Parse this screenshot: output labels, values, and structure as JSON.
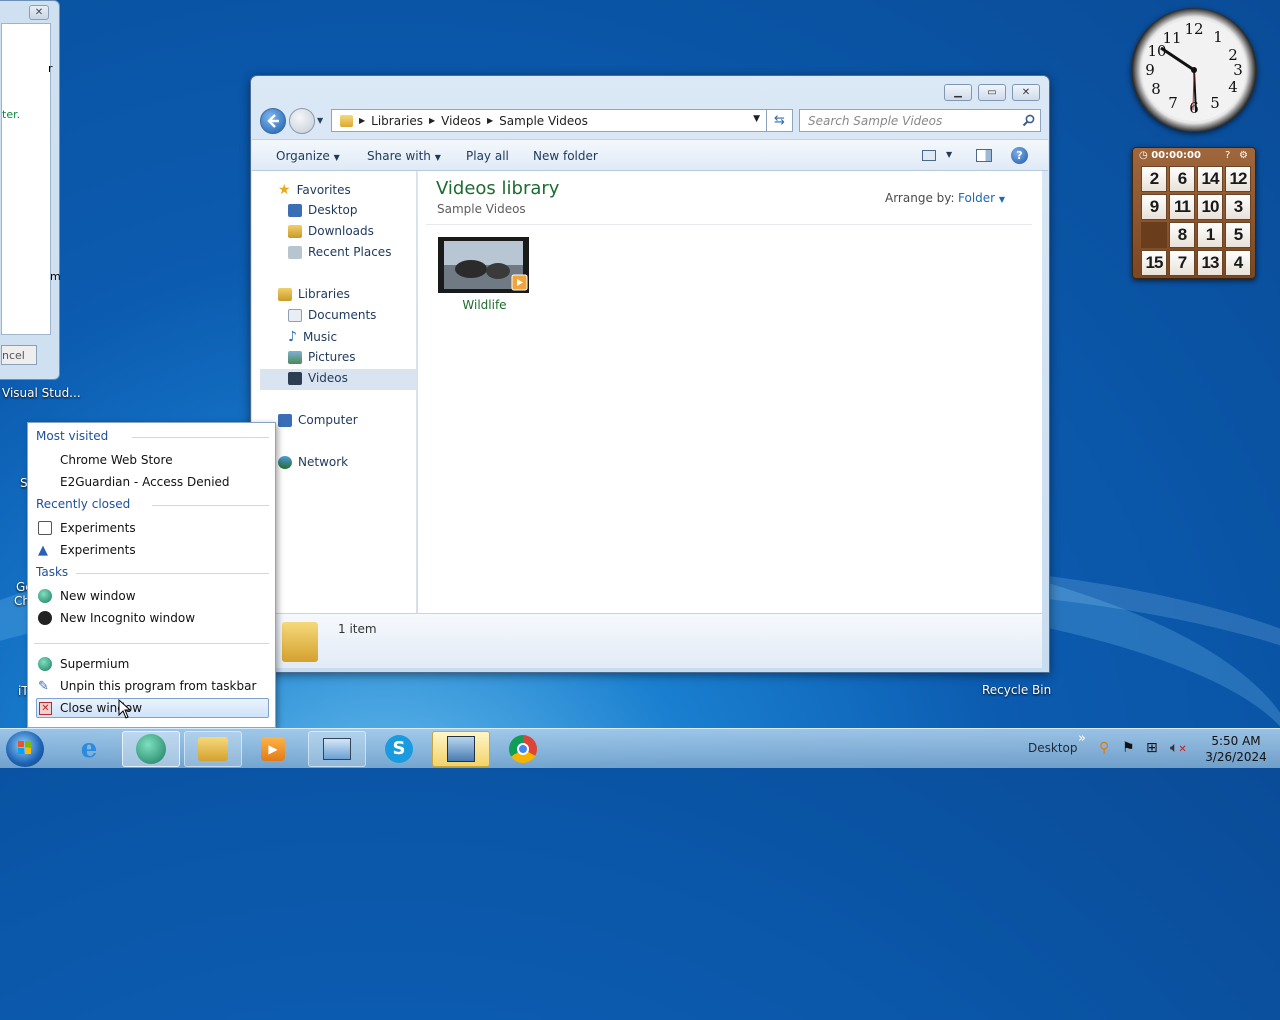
{
  "left_window": {
    "frag1": "r",
    "frag2": "ter.",
    "frag3": "m",
    "cancel": "ncel",
    "close_symbol": "✕"
  },
  "desktop": {
    "visual_studio_label": "Visual Stud...",
    "recycle_label": "Recycle Bin",
    "frag_s": "S",
    "frag_g": "Gc",
    "frag_ch": "Ch",
    "frag_it": "iT"
  },
  "explorer": {
    "breadcrumb": [
      "Libraries",
      "Videos",
      "Sample Videos"
    ],
    "search_placeholder": "Search Sample Videos",
    "toolbar": {
      "organize": "Organize",
      "share": "Share with",
      "play": "Play all",
      "newfolder": "New folder"
    },
    "nav": {
      "favorites": "Favorites",
      "desktop": "Desktop",
      "downloads": "Downloads",
      "recent": "Recent Places",
      "libraries": "Libraries",
      "documents": "Documents",
      "music": "Music",
      "pictures": "Pictures",
      "videos": "Videos",
      "computer": "Computer",
      "network": "Network"
    },
    "title": "Videos library",
    "subtitle": "Sample Videos",
    "arrange_label": "Arrange by:",
    "arrange_value": "Folder",
    "file": "Wildlife",
    "status": "1 item"
  },
  "jumplist": {
    "h_most": "Most visited",
    "most": [
      "Chrome Web Store",
      "E2Guardian - Access Denied"
    ],
    "h_recent": "Recently closed",
    "recent": [
      "Experiments",
      "Experiments"
    ],
    "h_tasks": "Tasks",
    "tasks": [
      "New window",
      "New Incognito window"
    ],
    "app": "Supermium",
    "unpin": "Unpin this program from taskbar",
    "close": "Close window"
  },
  "tray": {
    "desktop": "Desktop",
    "chevron": "»",
    "time": "5:50 AM",
    "date": "3/26/2024"
  },
  "gadgets": {
    "clock_numbers": [
      "12",
      "1",
      "2",
      "3",
      "4",
      "5",
      "6",
      "7",
      "8",
      "9",
      "10",
      "11"
    ],
    "timer": "00:00:00",
    "puzzle": [
      "2",
      "6",
      "14",
      "12",
      "9",
      "11",
      "10",
      "3",
      "",
      "8",
      "1",
      "5",
      "15",
      "7",
      "13",
      "4"
    ]
  }
}
